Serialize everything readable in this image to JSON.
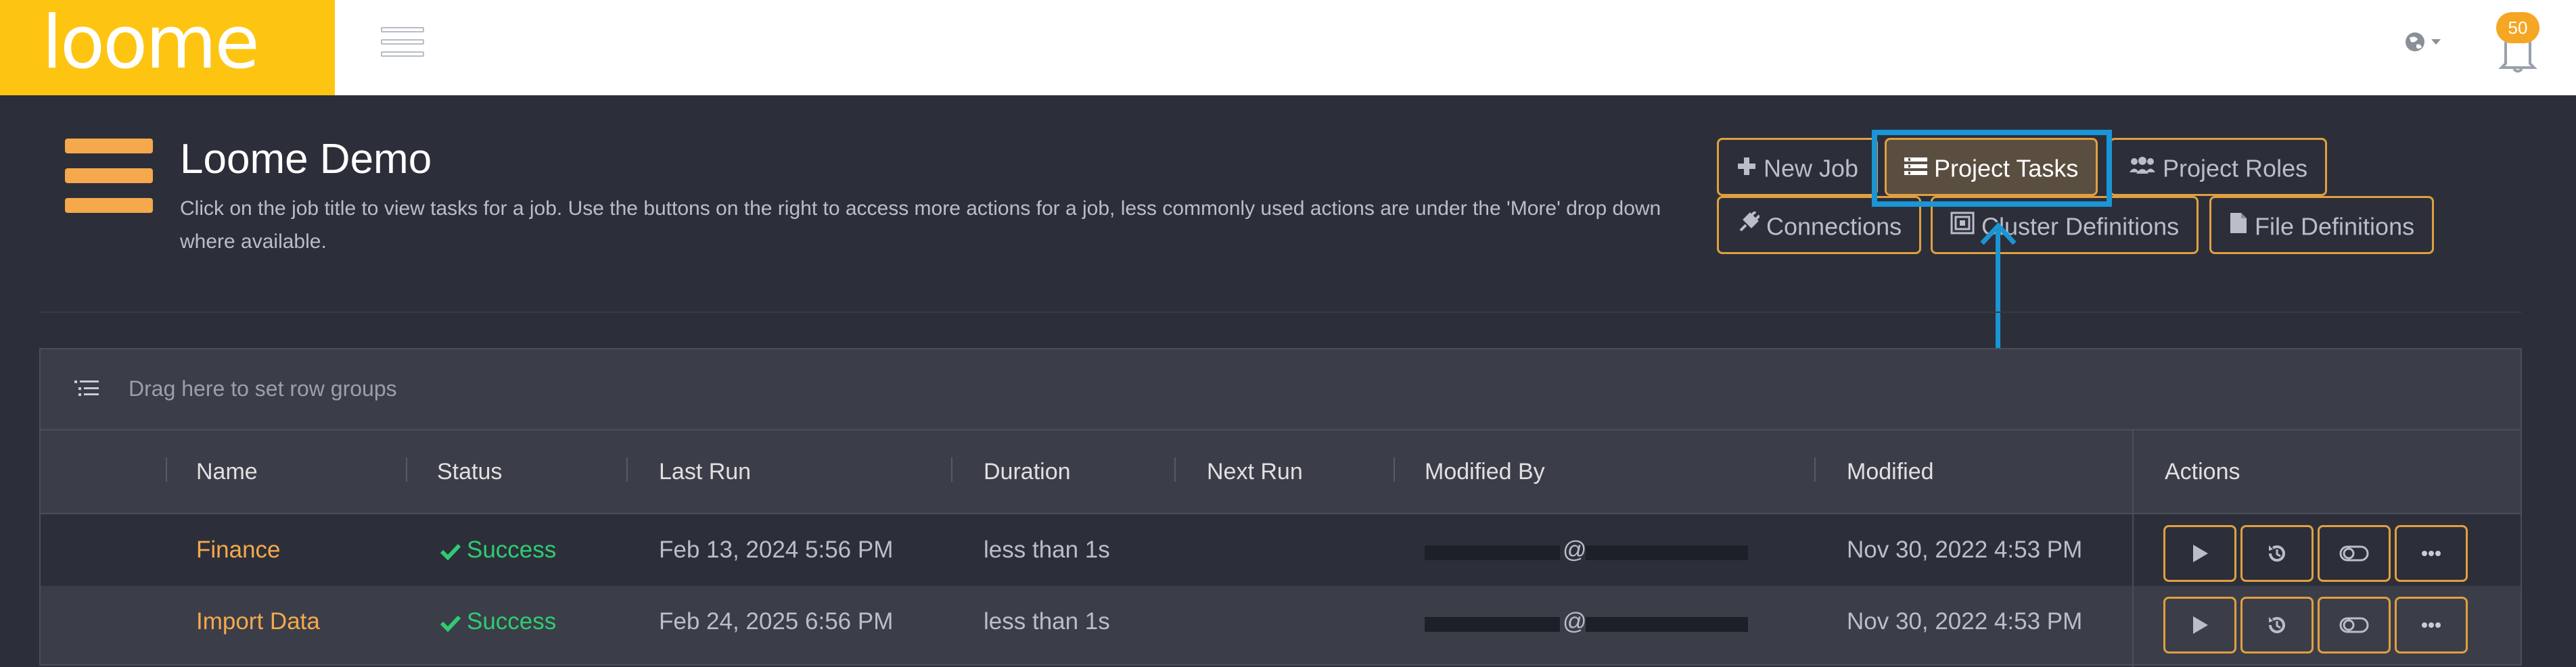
{
  "brand": {
    "logo_text": "loome",
    "logo_color": "#fdc512"
  },
  "notifications": {
    "count": "50"
  },
  "header": {
    "title": "Loome Demo",
    "description": "Click on the job title to view tasks for a job. Use the buttons on the right to access more actions for a job, less commonly used actions are under the 'More' drop down where available."
  },
  "toolbar": {
    "new_job": "New Job",
    "project_tasks": "Project Tasks",
    "project_roles": "Project Roles",
    "connections": "Connections",
    "cluster_definitions": "Cluster Definitions",
    "file_definitions": "File Definitions"
  },
  "grid": {
    "group_placeholder": "Drag here to set row groups",
    "columns": {
      "name": "Name",
      "status": "Status",
      "last_run": "Last Run",
      "duration": "Duration",
      "next_run": "Next Run",
      "modified_by": "Modified By",
      "modified": "Modified",
      "actions": "Actions"
    },
    "rows": [
      {
        "name": "Finance",
        "status": "Success",
        "last_run": "Feb 13, 2024 5:56 PM",
        "duration": "less than 1s",
        "next_run": "",
        "modified_by_at": "@",
        "modified": "Nov 30, 2022 4:53 PM"
      },
      {
        "name": "Import Data",
        "status": "Success",
        "last_run": "Feb 24, 2025 6:56 PM",
        "duration": "less than 1s",
        "next_run": "",
        "modified_by_at": "@",
        "modified": "Nov 30, 2022 4:53 PM"
      }
    ]
  },
  "colors": {
    "accent": "#f5a94c",
    "success": "#2ecc71",
    "highlight": "#1a95d5",
    "background": "#2c2f3a"
  },
  "icons": [
    "hamburger-icon",
    "globe-icon",
    "bell-icon",
    "plus-icon",
    "tasks-icon",
    "users-icon",
    "plug-icon",
    "cluster-icon",
    "file-icon",
    "group-rows-icon",
    "check-icon",
    "play-icon",
    "history-icon",
    "toggle-icon",
    "more-icon"
  ]
}
